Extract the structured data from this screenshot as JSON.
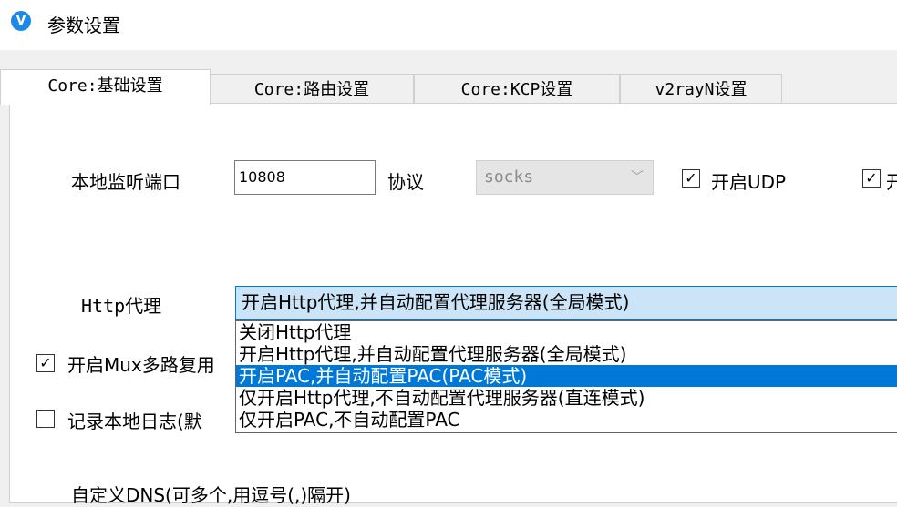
{
  "window": {
    "title": "参数设置",
    "icon": "v-logo-icon"
  },
  "tabs": [
    {
      "label": "Core:基础设置",
      "active": true
    },
    {
      "label": "Core:路由设置",
      "active": false
    },
    {
      "label": "Core:KCP设置",
      "active": false
    },
    {
      "label": "v2rayN设置",
      "active": false
    }
  ],
  "form": {
    "listen_port_label": "本地监听端口",
    "listen_port_value": "10808",
    "protocol_label": "协议",
    "protocol_value": "socks",
    "enable_udp": {
      "label": "开启UDP",
      "checked": true
    },
    "second_checkbox": {
      "label": "开",
      "checked": true
    },
    "http_proxy_label": "Http代理",
    "http_proxy_selected": "开启Http代理,并自动配置代理服务器(全局模式)",
    "http_proxy_options": [
      "关闭Http代理",
      "开启Http代理,并自动配置代理服务器(全局模式)",
      "开启PAC,并自动配置PAC(PAC模式)",
      "仅开启Http代理,不自动配置代理服务器(直连模式)",
      "仅开启PAC,不自动配置PAC"
    ],
    "highlighted_option_index": 2,
    "mux": {
      "label": "开启Mux多路复用",
      "checked": true
    },
    "log": {
      "label": "记录本地日志(默",
      "checked": false
    },
    "custom_dns_label": "自定义DNS(可多个,用逗号(,)隔开)"
  },
  "colors": {
    "accent": "#0078d7",
    "open_combo_bg": "#cce4f7",
    "app_icon": "#1e88e5"
  }
}
